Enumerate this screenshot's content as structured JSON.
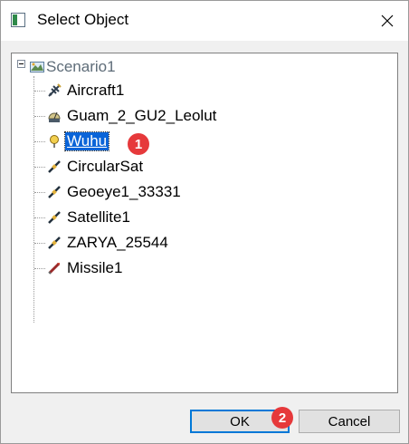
{
  "dialog": {
    "title": "Select Object",
    "icons": {
      "app": "app-window-icon",
      "close": "close-icon"
    }
  },
  "tree": {
    "root": {
      "label": "Scenario1",
      "icon": "scenario-icon",
      "expanded": true
    },
    "items": [
      {
        "label": "Aircraft1",
        "icon": "aircraft-icon",
        "selected": false
      },
      {
        "label": "Guam_2_GU2_Leolut",
        "icon": "ground-station-icon",
        "selected": false
      },
      {
        "label": "Wuhu",
        "icon": "place-pin-icon",
        "selected": true
      },
      {
        "label": "CircularSat",
        "icon": "satellite-icon",
        "selected": false
      },
      {
        "label": "Geoeye1_33331",
        "icon": "satellite-icon",
        "selected": false
      },
      {
        "label": "Satellite1",
        "icon": "satellite-icon",
        "selected": false
      },
      {
        "label": "ZARYA_25544",
        "icon": "satellite-icon",
        "selected": false
      },
      {
        "label": "Missile1",
        "icon": "missile-icon",
        "selected": false
      }
    ]
  },
  "annotations": {
    "badge1": "1",
    "badge2": "2"
  },
  "buttons": {
    "ok": "OK",
    "cancel": "Cancel"
  },
  "colors": {
    "selection": "#0a64d8",
    "badge": "#e6393b",
    "default_button_border": "#0078d7"
  }
}
